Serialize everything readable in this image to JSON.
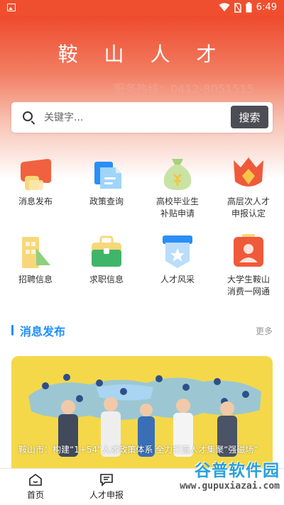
{
  "status_bar": {
    "time": "6:49"
  },
  "header": {
    "title": "鞍 山 人 才",
    "hotline": "服务热线：0412-8051515"
  },
  "search": {
    "placeholder": "关键字...",
    "button_label": "搜索"
  },
  "services": [
    {
      "label": "消息发布",
      "icon": "megaphone-icon"
    },
    {
      "label": "政策查询",
      "icon": "document-icon"
    },
    {
      "label": "高校毕业生补贴申请",
      "label_lines": [
        "高校毕业生",
        "补贴申请"
      ],
      "icon": "money-bag-icon"
    },
    {
      "label": "高层次人才申报认定",
      "label_lines": [
        "高层次人才",
        "申报认定"
      ],
      "icon": "diamond-award-icon"
    },
    {
      "label": "招聘信息",
      "icon": "building-icon"
    },
    {
      "label": "求职信息",
      "icon": "briefcase-icon"
    },
    {
      "label": "人才风采",
      "icon": "star-badge-icon"
    },
    {
      "label": "大学生鞍山消费一网通",
      "label_lines": [
        "大学生鞍山",
        "消费一网通"
      ],
      "icon": "person-card-icon"
    }
  ],
  "section": {
    "title": "消息发布",
    "more": "更多"
  },
  "banner": {
    "caption": "鞍山市：构建“1+54”人才政策体系 全力打造人才集聚“强磁场”"
  },
  "tabs": [
    {
      "label": "首页",
      "icon": "home-icon"
    },
    {
      "label": "人才申报",
      "icon": "message-icon"
    }
  ],
  "watermark": {
    "title": "谷普软件园",
    "url": "www.gupuxiazai.com"
  },
  "colors": {
    "brand": "#ee4a2c",
    "accent_blue": "#1f8fff",
    "search_button": "#4d4d55",
    "banner_bg": "#f4d84a"
  }
}
